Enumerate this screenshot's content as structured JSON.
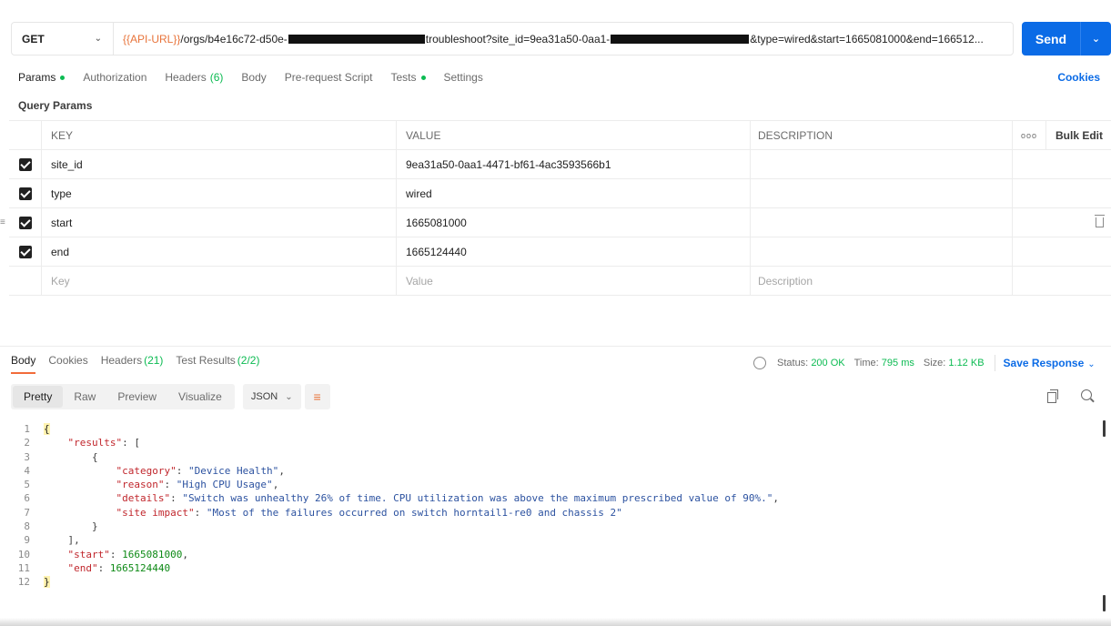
{
  "request": {
    "method": "GET",
    "url_var": "{{API-URL}}",
    "url_part1": "/orgs/b4e16c72-d50e-",
    "url_part2": "troubleshoot?site_id=9ea31a50-0aa1-",
    "url_part3": "&type=wired&start=1665081000&end=166512...",
    "send_label": "Send"
  },
  "req_tabs": {
    "params": "Params",
    "authorization": "Authorization",
    "headers": "Headers",
    "headers_count": "(6)",
    "body": "Body",
    "prerequest": "Pre-request Script",
    "tests": "Tests",
    "settings": "Settings",
    "cookies": "Cookies"
  },
  "query_params": {
    "title": "Query Params",
    "headers": {
      "key": "KEY",
      "value": "VALUE",
      "description": "DESCRIPTION",
      "bulk_edit": "Bulk Edit",
      "more": "ooo"
    },
    "rows": [
      {
        "key": "site_id",
        "value": "9ea31a50-0aa1-4471-bf61-4ac3593566b1",
        "checked": true
      },
      {
        "key": "type",
        "value": "wired",
        "checked": true
      },
      {
        "key": "start",
        "value": "1665081000",
        "checked": true
      },
      {
        "key": "end",
        "value": "1665124440",
        "checked": true
      }
    ],
    "placeholders": {
      "key": "Key",
      "value": "Value",
      "description": "Description"
    }
  },
  "response": {
    "tabs": {
      "body": "Body",
      "cookies": "Cookies",
      "headers": "Headers",
      "headers_count": "(21)",
      "test_results": "Test Results",
      "test_count": "(2/2)"
    },
    "status_label": "Status:",
    "status_value": "200 OK",
    "time_label": "Time:",
    "time_value": "795 ms",
    "size_label": "Size:",
    "size_value": "1.12 KB",
    "save_response": "Save Response",
    "view_modes": {
      "pretty": "Pretty",
      "raw": "Raw",
      "preview": "Preview",
      "visualize": "Visualize"
    },
    "format": "JSON",
    "code": {
      "line_numbers": [
        "1",
        "2",
        "3",
        "4",
        "5",
        "6",
        "7",
        "8",
        "9",
        "10",
        "11",
        "12"
      ],
      "open_brace": "{",
      "results_key": "\"results\"",
      "category_key": "\"category\"",
      "category_val": "\"Device Health\"",
      "reason_key": "\"reason\"",
      "reason_val": "\"High CPU Usage\"",
      "details_key": "\"details\"",
      "details_val": "\"Switch was unhealthy 26% of time. CPU utilization was above the maximum prescribed value of 90%.\"",
      "impact_key": "\"site impact\"",
      "impact_val": "\"Most of the failures occurred on switch horntail1-re0 and chassis 2\"",
      "start_key": "\"start\"",
      "start_val": "1665081000",
      "end_key": "\"end\"",
      "end_val": "1665124440",
      "close_brace": "}"
    }
  }
}
